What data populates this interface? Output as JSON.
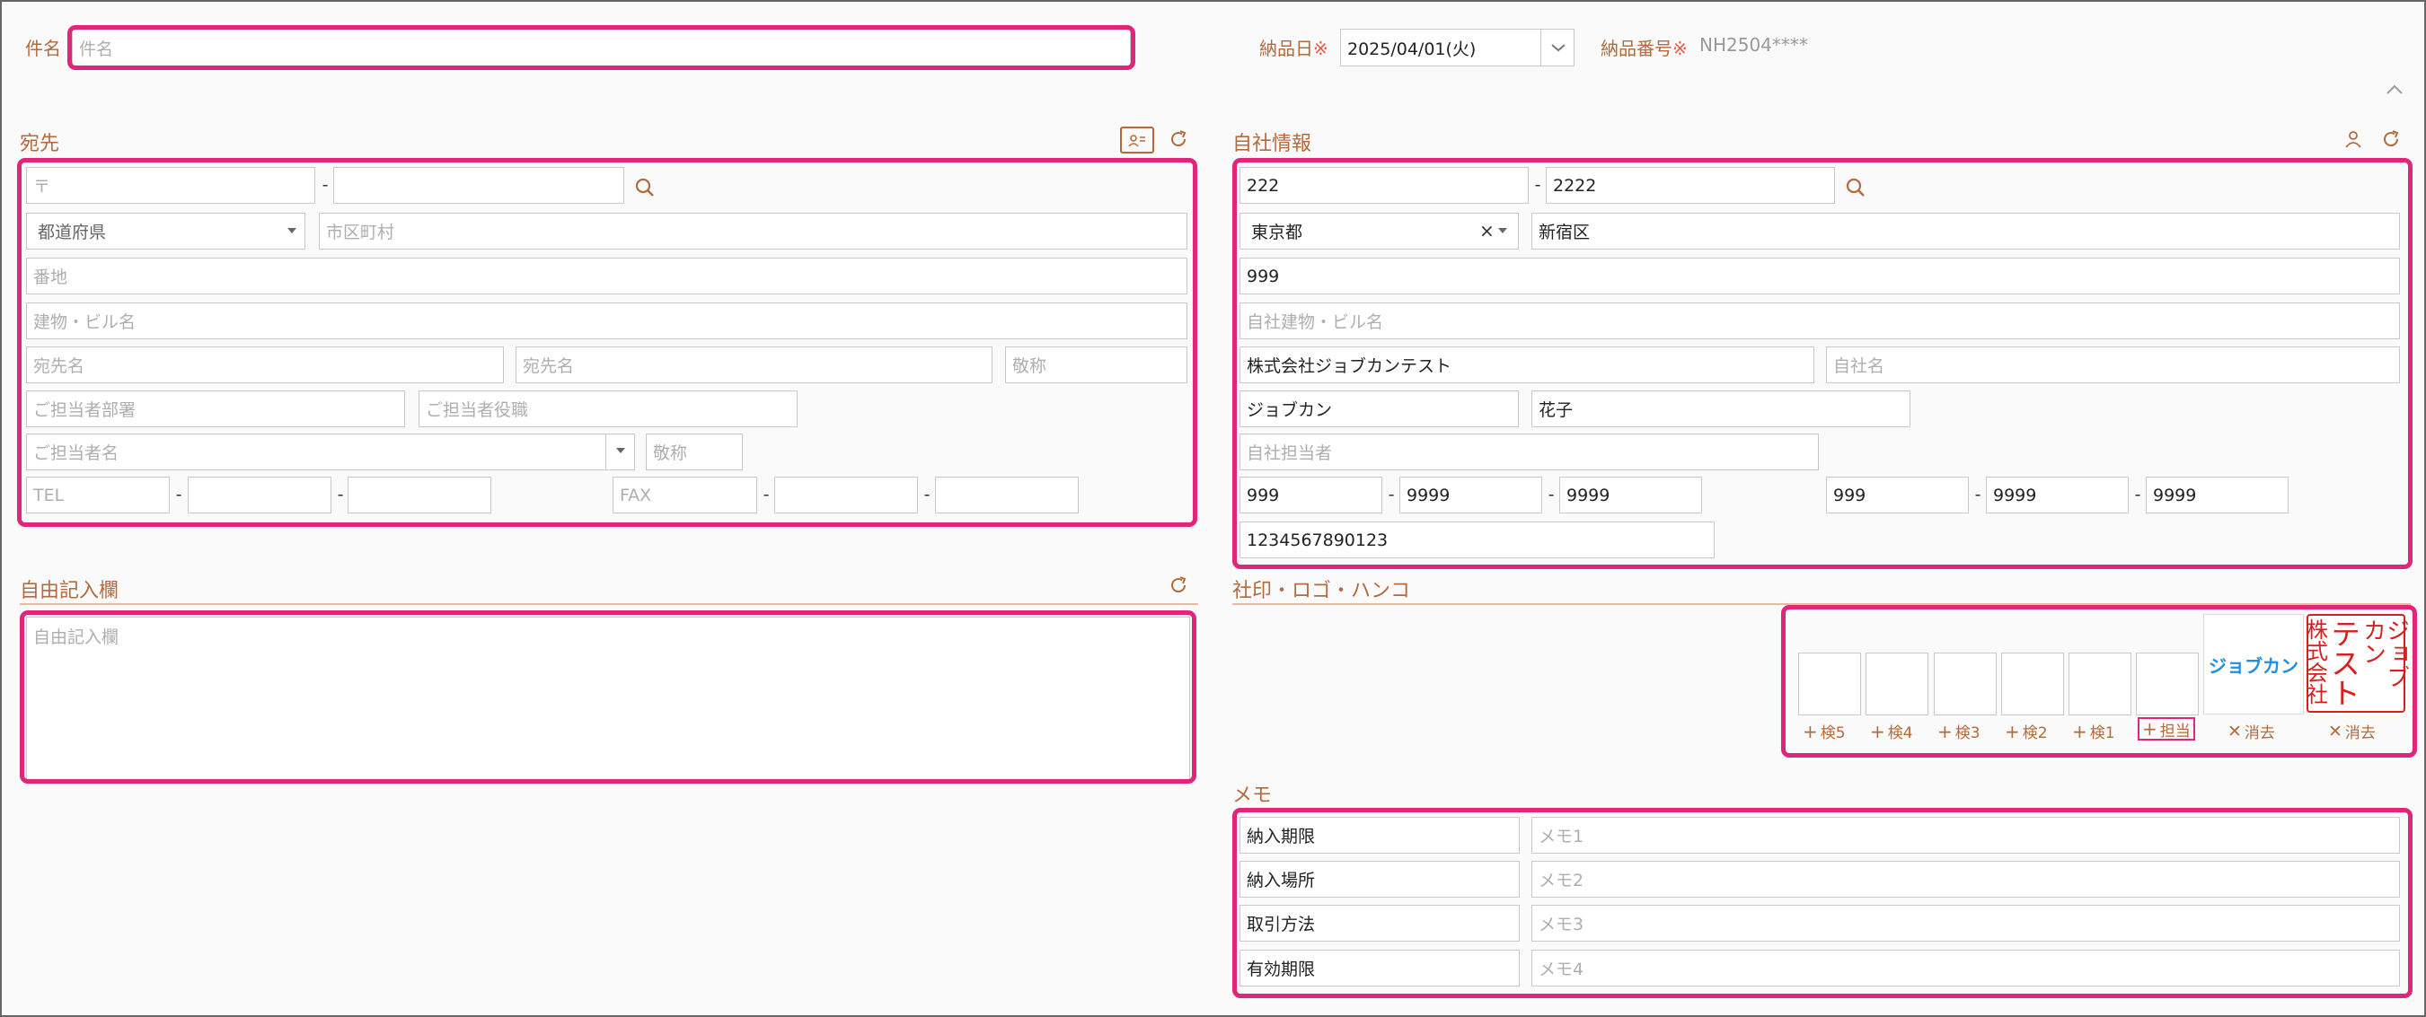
{
  "subject": {
    "label": "件名",
    "placeholder": "件名"
  },
  "delivery_date": {
    "label": "納品日",
    "required_mark": "※",
    "value": "2025/04/01(火)"
  },
  "delivery_number": {
    "label": "納品番号",
    "required_mark": "※",
    "value": "NH2504****"
  },
  "recipient": {
    "title": "宛先",
    "postal_placeholder": "〒",
    "prefecture_placeholder": "都道府県",
    "city_placeholder": "市区町村",
    "street_placeholder": "番地",
    "building_placeholder": "建物・ビル名",
    "name1_placeholder": "宛先名",
    "name2_placeholder": "宛先名",
    "honorific_placeholder": "敬称",
    "department_placeholder": "ご担当者部署",
    "position_placeholder": "ご担当者役職",
    "person_placeholder": "ご担当者名",
    "person_honorific_placeholder": "敬称",
    "tel_placeholder": "TEL",
    "fax_placeholder": "FAX"
  },
  "free_text": {
    "title": "自由記入欄",
    "placeholder": "自由記入欄"
  },
  "company": {
    "title": "自社情報",
    "postal1": "222",
    "postal2": "2222",
    "prefecture": "東京都",
    "clear_mark": "×",
    "city": "新宿区",
    "street": "999",
    "building_placeholder": "自社建物・ビル名",
    "company_name": "株式会社ジョブカンテスト",
    "company_name2_placeholder": "自社名",
    "last_name": "ジョブカン",
    "first_name": "花子",
    "person_placeholder": "自社担当者",
    "tel": [
      "999",
      "9999",
      "9999"
    ],
    "fax": [
      "999",
      "9999",
      "9999"
    ],
    "registration_number": "1234567890123"
  },
  "seal": {
    "title": "社印・ロゴ・ハンコ",
    "slots": [
      "検5",
      "検4",
      "検3",
      "検2",
      "検1",
      "担当"
    ],
    "logo_text": "ジョブカン",
    "stamp_lines": [
      "株式会社",
      "テスト",
      "ジョブカン"
    ],
    "clear_label": "消去",
    "plus_icon": "plus-icon",
    "clear_icon": "x-icon"
  },
  "memo": {
    "title": "メモ",
    "rows": [
      {
        "label": "納入期限",
        "placeholder": "メモ1"
      },
      {
        "label": "納入場所",
        "placeholder": "メモ2"
      },
      {
        "label": "取引方法",
        "placeholder": "メモ3"
      },
      {
        "label": "有効期限",
        "placeholder": "メモ4"
      }
    ]
  },
  "colors": {
    "accent": "#b46a3c",
    "highlight": "#e0267a",
    "stamp_red": "#d4201f",
    "logo_blue": "#1f8fe0"
  }
}
